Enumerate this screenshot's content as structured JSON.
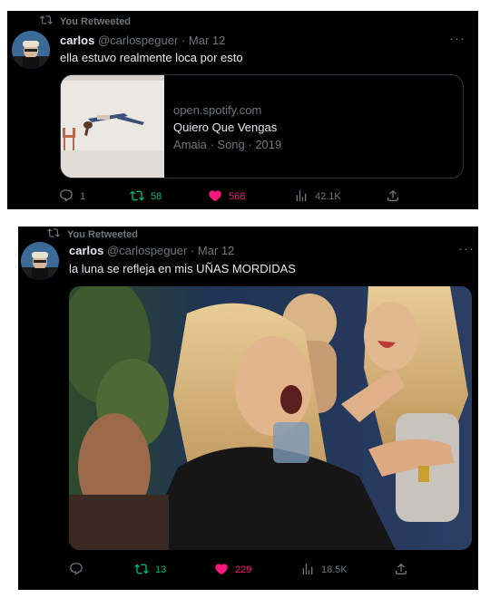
{
  "tweets": [
    {
      "retweet_label": "You Retweeted",
      "author_name": "carlos",
      "author_handle": "@carlospeguer",
      "separator": "·",
      "date": "Mar 12",
      "more_label": "···",
      "text": "ella estuvo realmente loca por esto",
      "card": {
        "domain": "open.spotify.com",
        "title": "Quiero Que Vengas",
        "subtitle": "Amaia · Song · 2019"
      },
      "replies": "1",
      "retweets": "58",
      "likes": "568",
      "views": "42.1K"
    },
    {
      "retweet_label": "You Retweeted",
      "author_name": "carlos",
      "author_handle": "@carlospeguer",
      "separator": "·",
      "date": "Mar 12",
      "more_label": "···",
      "text": "la luna se refleja en mis UÑAS MORDIDAS",
      "replies": "",
      "retweets": "13",
      "likes": "229",
      "views": "18.5K"
    }
  ],
  "colors": {
    "retweet_green": "#00ba7c",
    "like_pink": "#f91880",
    "muted": "#71767b",
    "text": "#e7e9ea"
  },
  "icons": [
    "retweet-icon",
    "reply-icon",
    "heart-icon",
    "views-icon",
    "share-icon",
    "more-icon"
  ]
}
